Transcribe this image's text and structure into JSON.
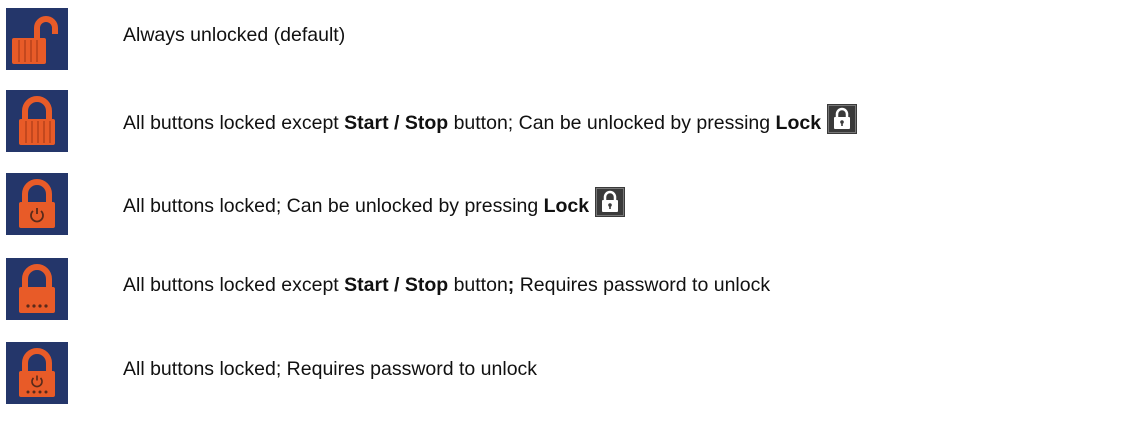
{
  "accent_color": "#e85b28",
  "tile_color": "#24366a",
  "lock_button_icon": "lock-button-icon",
  "items": [
    {
      "icon": "unlocked-padlock-icon",
      "text": "Always unlocked (default)"
    },
    {
      "icon": "locked-padlock-icon",
      "p1": "All buttons locked except ",
      "b1": "Start / Stop",
      "p2": " button;  Can be unlocked by pressing ",
      "b2": "Lock"
    },
    {
      "icon": "locked-padlock-power-icon",
      "p1": "All buttons locked;  Can be unlocked by pressing ",
      "b1": "Lock"
    },
    {
      "icon": "locked-padlock-password-icon",
      "p1": "All buttons locked except ",
      "b1": "Start / Stop",
      "p2": " button",
      "b2": ";",
      "p3": "  Requires password to unlock"
    },
    {
      "icon": "locked-padlock-power-password-icon",
      "text": "All buttons locked; Requires password to unlock"
    }
  ]
}
